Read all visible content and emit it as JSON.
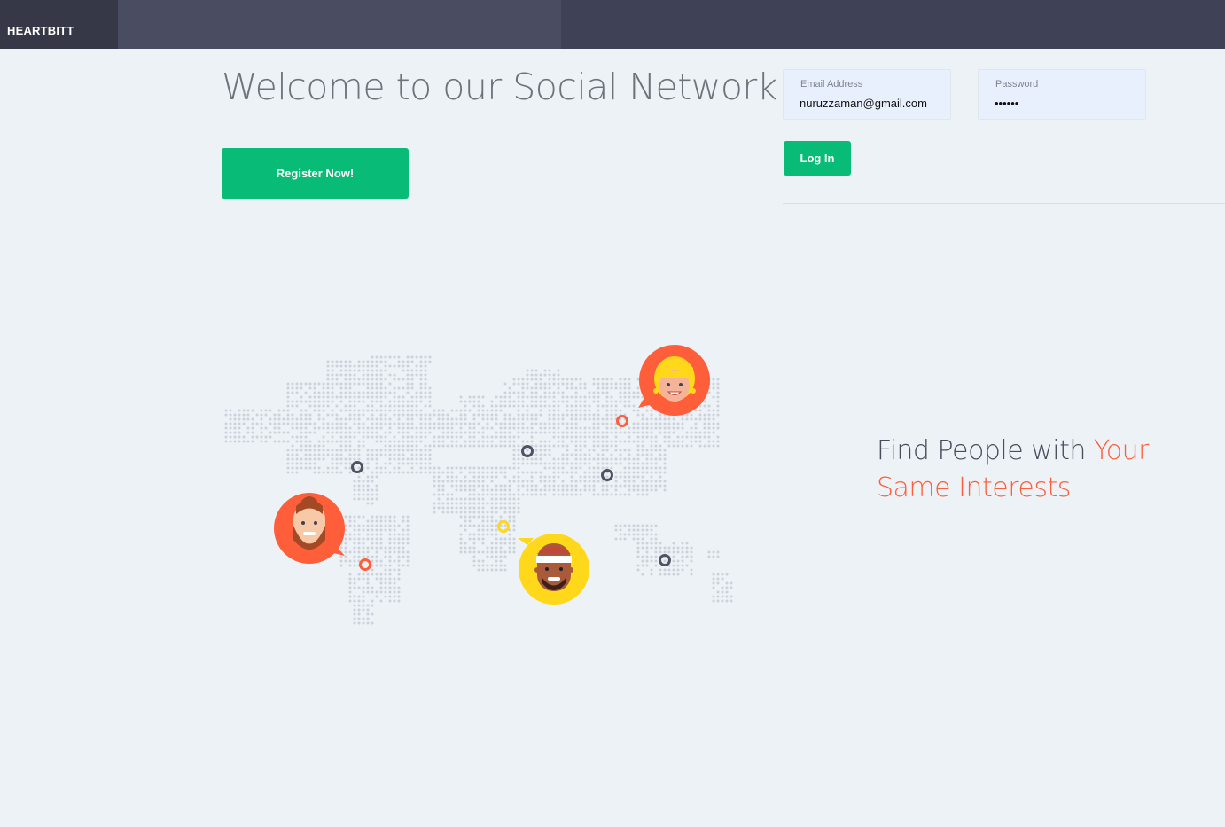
{
  "header": {
    "brand": "HEARTBITT"
  },
  "hero": {
    "title": "Welcome to our Social Network",
    "register_label": "Register Now!"
  },
  "login": {
    "email_label": "Email Address",
    "email_value": "nuruzzaman@gmail.com",
    "password_label": "Password",
    "password_value": "••••••",
    "login_label": "Log In"
  },
  "tagline": {
    "prefix": "Find People with ",
    "highlight": "Your Same Interests"
  },
  "map": {
    "avatars": [
      "woman-avatar-icon",
      "bearded-man-avatar-icon",
      "headband-man-avatar-icon"
    ],
    "colors": {
      "dots": "#cdd1dc",
      "pin_dark": "#515365",
      "pin_orange": "#ff5e3a",
      "pin_yellow": "#ffd71b"
    }
  },
  "colors": {
    "topbar": "#3f4257",
    "accent_green": "#08bb76",
    "accent_orange": "#ff5e3a",
    "background": "#edf2f6"
  }
}
